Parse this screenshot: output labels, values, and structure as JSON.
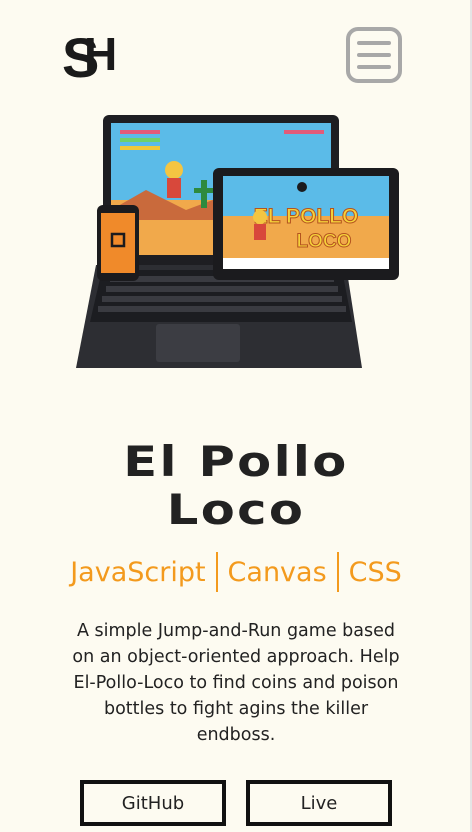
{
  "header": {
    "logo_text": "SH",
    "menu_icon": "hamburger-menu-icon"
  },
  "project": {
    "image_alt": "El Pollo Loco on laptop, tablet and phone",
    "game_logo_line1": "EL POLLO",
    "game_logo_line2": "LOCO",
    "title_line1": "El Pollo",
    "title_line2": "Loco",
    "technologies": [
      "JavaScript",
      "Canvas",
      "CSS"
    ],
    "description": "A simple Jump-and-Run game based on an object-oriented approach. Help El-Pollo-Loco to find coins and poison bottles to fight agins the killer endboss."
  },
  "buttons": {
    "github_label": "GitHub",
    "live_label": "Live"
  },
  "colors": {
    "background": "#fdfbf1",
    "accent": "#f39a1d",
    "text": "#222222",
    "menu_border": "#a8a8a8"
  }
}
